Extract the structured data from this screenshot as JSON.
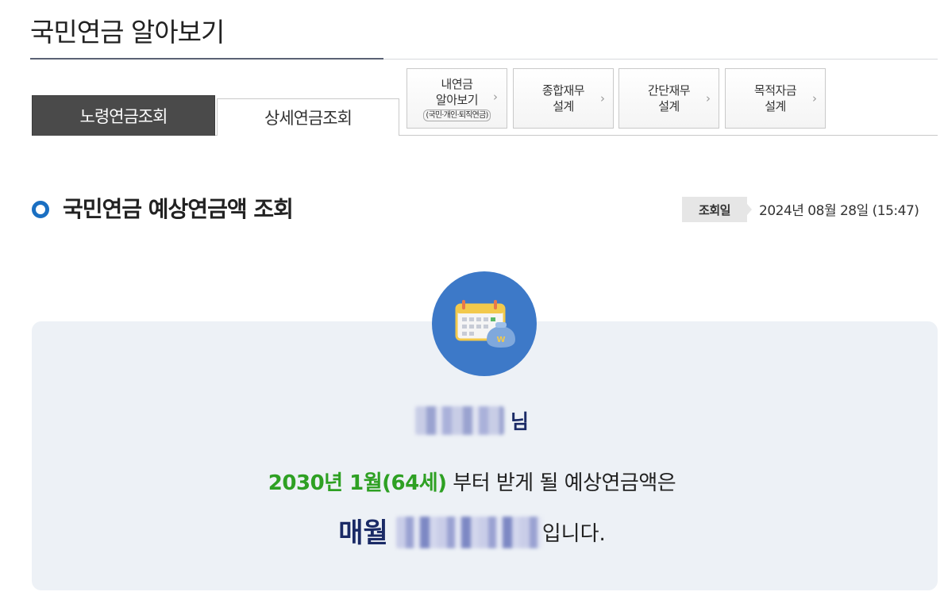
{
  "header": {
    "title": "국민연금 알아보기"
  },
  "tabs": [
    {
      "label": "노령연금조회",
      "active": true
    },
    {
      "label": "상세연금조회",
      "active": false
    }
  ],
  "quick_links": [
    {
      "line1": "내연금",
      "line2": "알아보기",
      "sub": "(국민·개인·퇴직연금)"
    },
    {
      "line1": "종합재무",
      "line2": "설계"
    },
    {
      "line1": "간단재무",
      "line2": "설계"
    },
    {
      "line1": "목적자금",
      "line2": "설계"
    }
  ],
  "section": {
    "title": "국민연금 예상연금액 조회",
    "date_label": "조회일",
    "date_value": "2024년 08월 28일 (15:47)"
  },
  "result": {
    "name_suffix": "님",
    "start_highlight": "2030년 1월(64세)",
    "start_rest": " 부터 받게 될 예상연금액은",
    "monthly_label": "매월",
    "amount_suffix": "입니다."
  },
  "colors": {
    "accent_blue": "#1a6fc2",
    "highlight_green": "#2ea023",
    "navy": "#1a2a66",
    "panel_bg": "#edf1f6",
    "icon_circle": "#3d79c8"
  },
  "icons": {
    "section": "circle-bullet-icon",
    "calendar": "calendar-money-icon",
    "chevron": "chevron-right-icon"
  }
}
